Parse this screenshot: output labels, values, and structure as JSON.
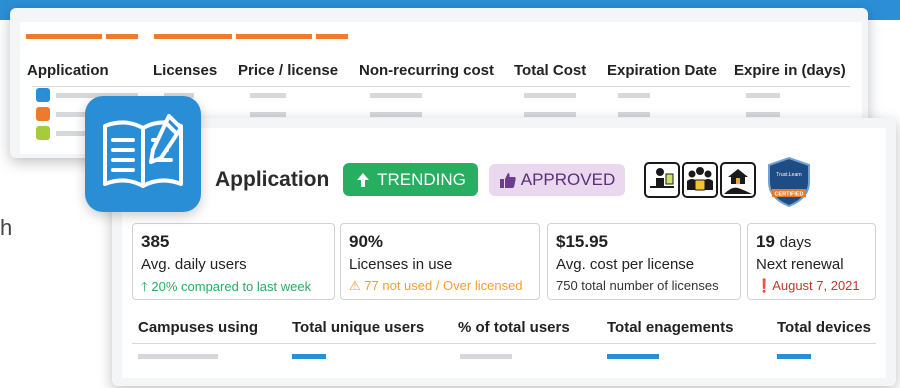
{
  "license_table": {
    "columns": [
      "Application",
      "Licenses",
      "Price / license",
      "Non-recurring cost",
      "Total Cost",
      "Expiration Date",
      "Expire in (days)"
    ],
    "row_colors": [
      "#2a8ed6",
      "#ef7a2c",
      "#a6cc3a"
    ]
  },
  "side_text": "h",
  "app_card": {
    "title": "Application",
    "trending_label": "TRENDING",
    "approved_label": "APPROVED",
    "shield_label": "CERTIFIED",
    "shield_top": "Trust.Learn",
    "stats": [
      {
        "value": "385",
        "label": "Avg. daily users",
        "sub": "20% compared to last week"
      },
      {
        "value": "90%",
        "label": "Licenses in use",
        "sub": "77 not used / Over licensed"
      },
      {
        "value": "$15.95",
        "label": "Avg. cost per license",
        "sub": "750 total number of licenses"
      },
      {
        "value": "19",
        "unit": "days",
        "label": "Next renewal",
        "sub": "August 7, 2021"
      }
    ],
    "columns": [
      "Campuses using",
      "Total unique users",
      "% of total users",
      "Total enagements",
      "Total devices"
    ]
  },
  "colors": {
    "brand_blue": "#2a8ed6",
    "accent_orange": "#ef7a2c",
    "trending_green": "#27ae60",
    "approved_bg": "#ead9ee"
  }
}
